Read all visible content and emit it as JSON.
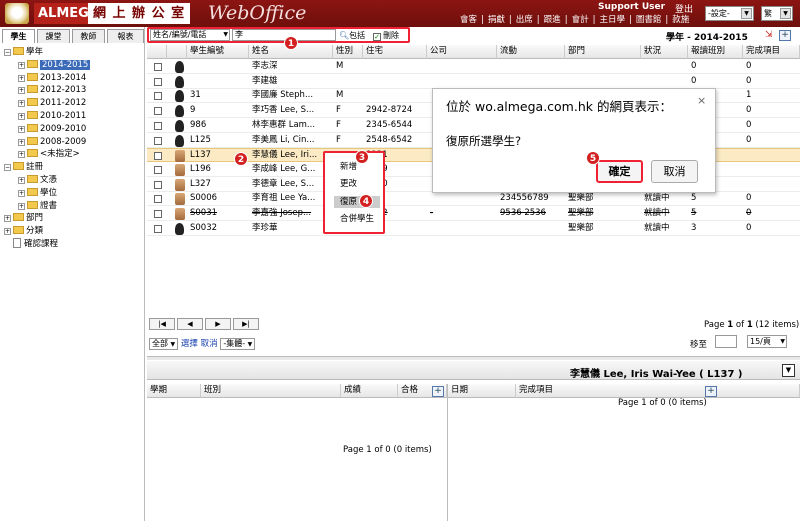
{
  "header": {
    "brand": "ALMEGA",
    "office_cn": "網 上 辦 公 室",
    "webtitle": "WebOffice",
    "user": "Support User",
    "logout": "登出",
    "nav": [
      "會客",
      "捐獻",
      "出席",
      "跟進",
      "會計",
      "主日學",
      "圖書館",
      "款施"
    ],
    "setting_select": "-設定-",
    "lang_select": "繁"
  },
  "left": {
    "tabs": [
      "學生",
      "課堂",
      "教師",
      "報表"
    ],
    "tree": [
      {
        "label": "學年",
        "level": 0,
        "type": "root",
        "toggle": "−"
      },
      {
        "label": "2014-2015",
        "level": 1,
        "type": "folder",
        "toggle": "+",
        "selected": true
      },
      {
        "label": "2013-2014",
        "level": 1,
        "type": "folder",
        "toggle": "+"
      },
      {
        "label": "2012-2013",
        "level": 1,
        "type": "folder",
        "toggle": "+"
      },
      {
        "label": "2011-2012",
        "level": 1,
        "type": "folder",
        "toggle": "+"
      },
      {
        "label": "2010-2011",
        "level": 1,
        "type": "folder",
        "toggle": "+"
      },
      {
        "label": "2009-2010",
        "level": 1,
        "type": "folder",
        "toggle": "+"
      },
      {
        "label": "2008-2009",
        "level": 1,
        "type": "folder",
        "toggle": "+"
      },
      {
        "label": "<未指定>",
        "level": 1,
        "type": "folder",
        "toggle": "+"
      },
      {
        "label": "註冊",
        "level": 0,
        "type": "root",
        "toggle": "−"
      },
      {
        "label": "文憑",
        "level": 1,
        "type": "folder",
        "toggle": "+"
      },
      {
        "label": "學位",
        "level": 1,
        "type": "folder",
        "toggle": "+"
      },
      {
        "label": "證書",
        "level": 1,
        "type": "folder",
        "toggle": "+"
      },
      {
        "label": "部門",
        "level": 0,
        "type": "root",
        "toggle": "+"
      },
      {
        "label": "分類",
        "level": 0,
        "type": "root",
        "toggle": "+"
      },
      {
        "label": "確認課程",
        "level": 0,
        "type": "doc",
        "toggle": ""
      }
    ]
  },
  "search": {
    "field": "姓名/編號/電話",
    "value": "李",
    "contains": "包括",
    "deleted": "刪除"
  },
  "year_title": "學年 - 2014-2015",
  "grid": {
    "columns": [
      "",
      "",
      "學生編號",
      "姓名",
      "性別",
      "住宅",
      "公司",
      "流動",
      "部門",
      "狀況",
      "報讀班別",
      "完成項目"
    ],
    "rows": [
      {
        "id": "",
        "name": "李志深",
        "sex": "M",
        "home": "",
        "office": "",
        "mobile": "",
        "dept": "",
        "status": "",
        "cls": "0",
        "done": "0",
        "avatar": "silhouette"
      },
      {
        "id": "",
        "name": "李建雄",
        "sex": "",
        "home": "",
        "office": "",
        "mobile": "",
        "dept": "",
        "status": "",
        "cls": "0",
        "done": "0",
        "avatar": "silhouette"
      },
      {
        "id": "31",
        "name": "李國廉 Steph...",
        "sex": "M",
        "home": "",
        "office": "",
        "mobile": "",
        "dept": "",
        "status": "",
        "cls": "0",
        "done": "1",
        "avatar": "silhouette"
      },
      {
        "id": "9",
        "name": "李巧香 Lee, S...",
        "sex": "F",
        "home": "2942-8724",
        "office": "",
        "mobile": "",
        "dept": "",
        "status": "",
        "cls": "0",
        "done": "0",
        "avatar": "silhouette"
      },
      {
        "id": "986",
        "name": "林李惠群 Lam...",
        "sex": "F",
        "home": "2345-6544",
        "office": "",
        "mobile": "",
        "dept": "",
        "status": "",
        "cls": "0",
        "done": "0",
        "avatar": "silhouette"
      },
      {
        "id": "L125",
        "name": "李美鳳 Li, Cin...",
        "sex": "F",
        "home": "2548-6542",
        "office": "",
        "mobile": "",
        "dept": "",
        "status": "",
        "cls": "0",
        "done": "0",
        "avatar": "silhouette"
      },
      {
        "id": "L137",
        "name": "李慧儀 Lee, Iri...",
        "sex": "",
        "home": "9121",
        "office": "",
        "mobile": "",
        "dept": "",
        "status": "",
        "cls": "",
        "done": "",
        "avatar": "photo",
        "selected": true
      },
      {
        "id": "L196",
        "name": "李成峰 Lee, G...",
        "sex": "",
        "home": "8319",
        "office": "",
        "mobile": "",
        "dept": "",
        "status": "",
        "cls": "",
        "done": "",
        "avatar": "photo"
      },
      {
        "id": "L327",
        "name": "李德章 Lee, S...",
        "sex": "",
        "home": "2430",
        "office": "",
        "mobile": "",
        "dept": "",
        "status": "",
        "cls": "",
        "done": "",
        "avatar": "photo"
      },
      {
        "id": "S0006",
        "name": "李育祖 Lee Ya...",
        "sex": "",
        "home": "",
        "office": "",
        "mobile": "234556789",
        "dept": "聖樂部",
        "status": "就讀中",
        "cls": "5",
        "done": "0",
        "avatar": "photo"
      },
      {
        "id": "S0031",
        "name": "李嘉強 Josep...",
        "sex": "",
        "home": "9512",
        "office": "-",
        "mobile": "9536 2536",
        "dept": "聖樂部",
        "status": "就讀中",
        "cls": "5",
        "done": "0",
        "avatar": "photo",
        "strike": true
      },
      {
        "id": "S0032",
        "name": "李珍華",
        "sex": "F",
        "home": "",
        "office": "",
        "mobile": "",
        "dept": "聖樂部",
        "status": "就讀中",
        "cls": "3",
        "done": "0",
        "avatar": "silhouette"
      }
    ]
  },
  "context_menu": [
    "新增",
    "更改",
    "復原",
    "合併學生"
  ],
  "dialog": {
    "title": "位於 wo.almega.com.hk 的網頁表示：",
    "message": "復原所選學生?",
    "ok": "確定",
    "cancel": "取消",
    "close": "×"
  },
  "badges": [
    "1",
    "2",
    "3",
    "4",
    "5"
  ],
  "pager": {
    "first": "|◀",
    "prev": "◀",
    "next": "▶",
    "last": "▶|",
    "page_prefix": "Page ",
    "page": "1",
    "of": " of ",
    "total": "1",
    "items": " (12 items)"
  },
  "filter": {
    "scope": "全部",
    "select": "選擇",
    "cancel": "取消",
    "group": "-集體-",
    "move_to": "移至",
    "page_size": "15/頁"
  },
  "detail": {
    "title": "李慧儀 Lee, Iris Wai-Yee ( L137 )",
    "left_cols": [
      "學期",
      "班別",
      "成績",
      "合格"
    ],
    "right_cols": [
      "日期",
      "完成項目"
    ],
    "left_empty": "Page 1 of 0 (0 items)",
    "right_empty": "Page 1 of 0 (0 items)",
    "plus": "+",
    "menu": "▼"
  }
}
